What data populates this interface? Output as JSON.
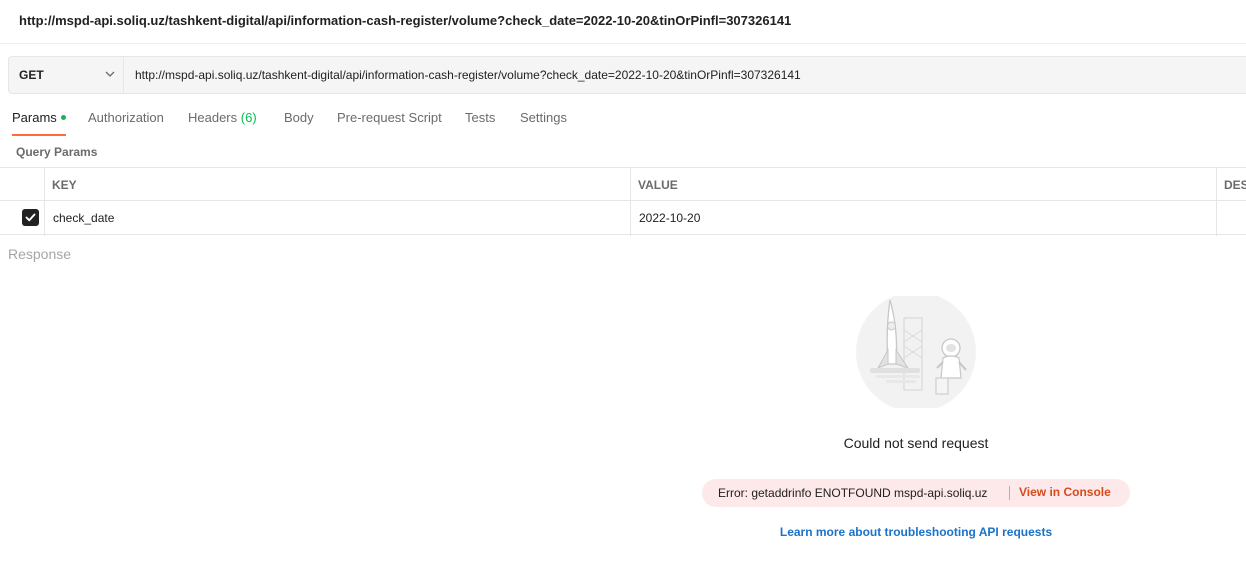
{
  "request": {
    "title": "http://mspd-api.soliq.uz/tashkent-digital/api/information-cash-register/volume?check_date=2022-10-20&tinOrPinfl=307326141",
    "method": "GET",
    "url": "http://mspd-api.soliq.uz/tashkent-digital/api/information-cash-register/volume?check_date=2022-10-20&tinOrPinfl=307326141"
  },
  "tabs": {
    "params": "Params",
    "authorization": "Authorization",
    "headers": "Headers",
    "headers_count": "(6)",
    "body": "Body",
    "prerequest": "Pre-request Script",
    "tests": "Tests",
    "settings": "Settings"
  },
  "query_params": {
    "title": "Query Params",
    "columns": {
      "key": "KEY",
      "value": "VALUE",
      "description": "DES"
    },
    "rows": [
      {
        "checked": true,
        "key": "check_date",
        "value": "2022-10-20"
      }
    ]
  },
  "response": {
    "label": "Response",
    "empty_title": "Could not send request",
    "error_text": "Error: getaddrinfo ENOTFOUND mspd-api.soliq.uz",
    "console_link": "View in Console",
    "learn_link": "Learn more about troubleshooting API requests"
  },
  "colors": {
    "accent": "#ff6c37",
    "success": "#0cbb52",
    "error_bg": "#fde9e9",
    "error_link": "#d64a1c",
    "link": "#1a73c8"
  },
  "icons": [
    "chevron-down-icon",
    "check-icon",
    "rocket-astronaut-illustration"
  ]
}
